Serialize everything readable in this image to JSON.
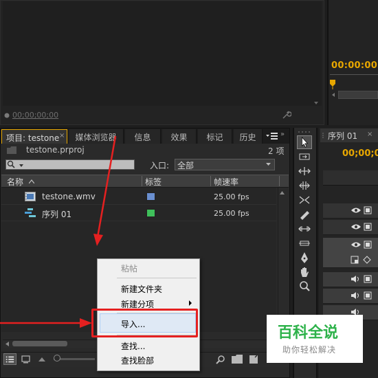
{
  "source_monitor": {
    "timecode": "00;00;00;00"
  },
  "program_monitor": {
    "timecode": "00:00:00:0"
  },
  "project_panel": {
    "tabs": [
      {
        "label": "项目: testone"
      },
      {
        "label": "媒体浏览器"
      },
      {
        "label": "信息"
      },
      {
        "label": "效果"
      },
      {
        "label": "标记"
      },
      {
        "label": "历史"
      }
    ],
    "close_glyph": "×",
    "menu_glyph": "▾☰",
    "overflow_glyph": "»",
    "project_file": "testone.prproj",
    "item_count": "2 项",
    "search": {
      "placeholder": ""
    },
    "entry_label": "入口:",
    "entry_value": "全部",
    "columns": {
      "name": "名称",
      "label": "标签",
      "fps": "帧速率"
    },
    "rows": [
      {
        "name": "testone.wmv",
        "fps": "25.00 fps",
        "label_color": "#6a8fd0",
        "icon": "video-clip-icon"
      },
      {
        "name": "序列 01",
        "fps": "25.00 fps",
        "label_color": "#3fbf5a",
        "icon": "sequence-icon"
      }
    ]
  },
  "timeline_panel": {
    "tab_label": "序列 01",
    "close_glyph": "×",
    "timecode": "00;00;0"
  },
  "context_menu": {
    "items": {
      "paste": "粘帖",
      "new_bin": "新建文件夹",
      "new_item": "新建分项",
      "import": "导入...",
      "find": "查找...",
      "find_face": "查找脸部"
    },
    "submenu_arrow": "▶"
  },
  "watermark": {
    "title": "百科全说",
    "subtitle": "助你轻松解决"
  },
  "colors": {
    "accent_timecode": "#e8a700",
    "annotation_red": "#e52020",
    "watermark_green": "#2db24a"
  }
}
